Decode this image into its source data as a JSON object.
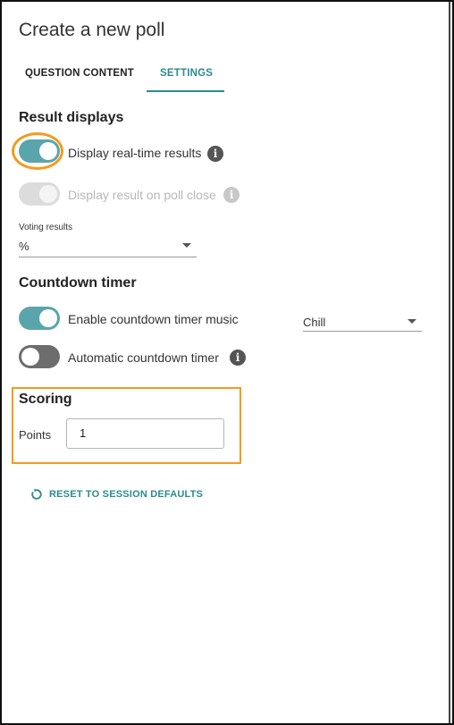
{
  "dialog": {
    "title": "Create a new poll"
  },
  "tabs": [
    {
      "label": "QUESTION CONTENT",
      "active": false
    },
    {
      "label": "SETTINGS",
      "active": true
    }
  ],
  "result_displays": {
    "heading": "Result displays",
    "realtime": {
      "label": "Display real-time results",
      "on": true
    },
    "on_close": {
      "label": "Display result on poll close",
      "on": true,
      "disabled": true
    },
    "voting_results": {
      "label": "Voting results",
      "value": "%"
    }
  },
  "countdown": {
    "heading": "Countdown timer",
    "music": {
      "label": "Enable countdown timer music",
      "on": true,
      "track": "Chill"
    },
    "automatic": {
      "label": "Automatic countdown timer",
      "on": false
    }
  },
  "scoring": {
    "heading": "Scoring",
    "points_label": "Points",
    "points_value": "1"
  },
  "reset": {
    "label": "RESET TO SESSION DEFAULTS"
  },
  "colors": {
    "accent": "#2a8b8f",
    "toggle_on": "#5aa5ab",
    "toggle_off": "#6d6d6d",
    "highlight": "#f39b1f"
  }
}
